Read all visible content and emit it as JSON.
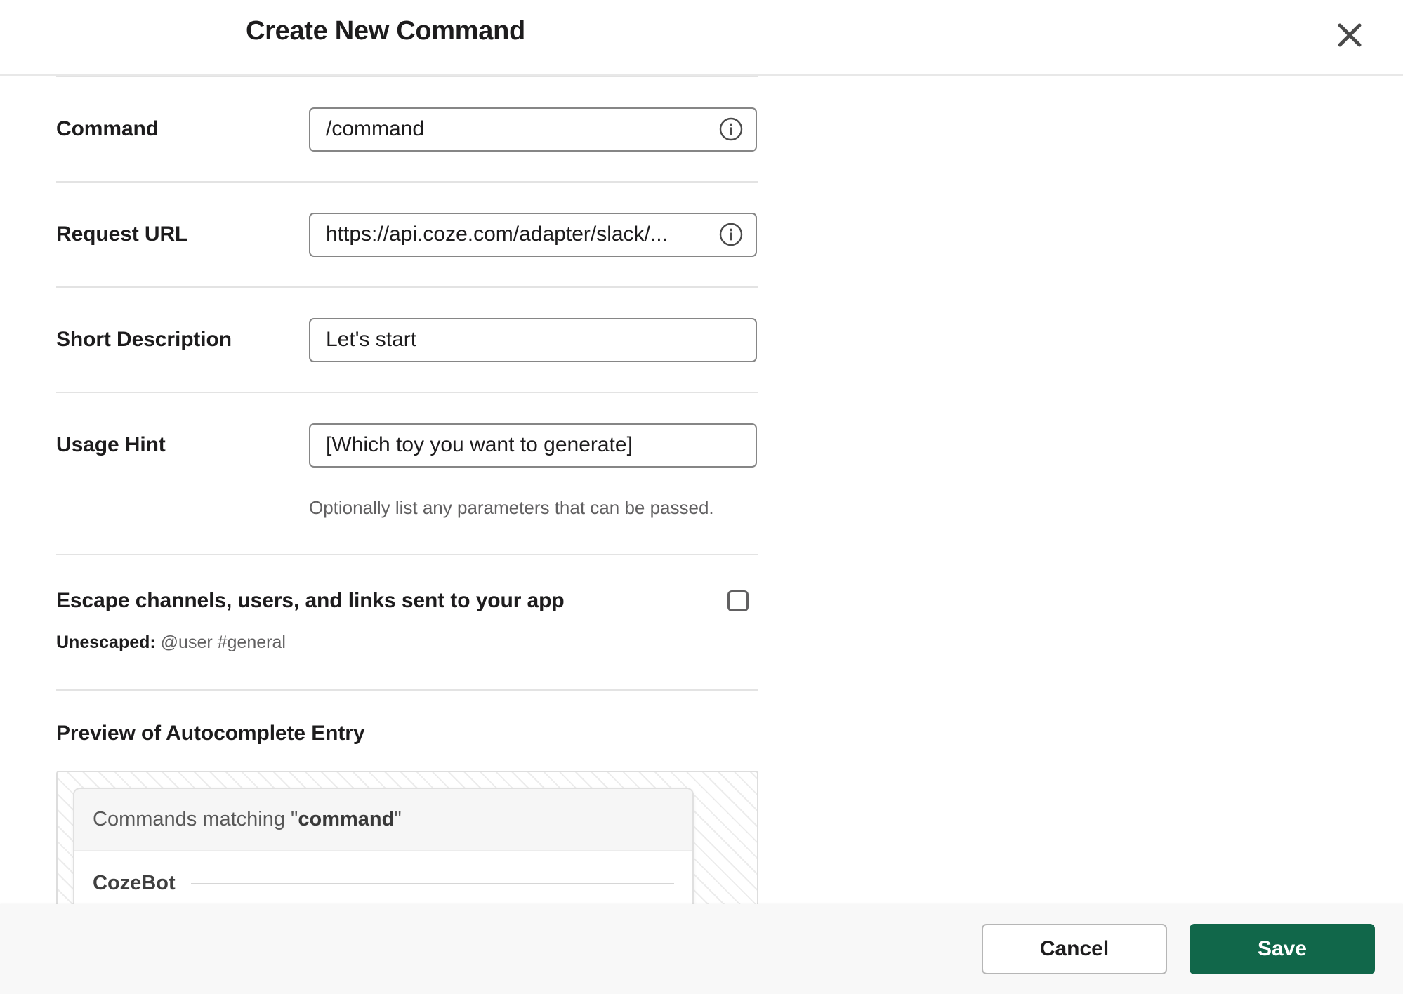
{
  "header": {
    "title": "Create New Command",
    "close_icon": "close-icon"
  },
  "form": {
    "fields": [
      {
        "label": "Command",
        "value": "/command",
        "has_info_icon": true,
        "info_icon": "info-circle-icon"
      },
      {
        "label": "Request URL",
        "value": "https://api.coze.com/adapter/slack/...",
        "has_info_icon": true,
        "info_icon": "info-circle-icon"
      },
      {
        "label": "Short Description",
        "value": "Let's start",
        "has_info_icon": false
      },
      {
        "label": "Usage Hint",
        "value": "[Which toy you want to generate]",
        "has_info_icon": false
      }
    ],
    "usage_hint_helper": "Optionally list any parameters that can be passed."
  },
  "escape": {
    "label": "Escape channels, users, and links sent to your app",
    "checked": false,
    "unescaped_label": "Unescaped:",
    "unescaped_value": "@user #general"
  },
  "preview": {
    "heading": "Preview of Autocomplete Entry",
    "matching_prefix": "Commands matching \"",
    "matching_term": "command",
    "matching_suffix": "\"",
    "group_name": "CozeBot"
  },
  "footer": {
    "cancel_label": "Cancel",
    "save_label": "Save"
  },
  "colors": {
    "save_green": "#11674a",
    "text_primary": "#1d1c1d",
    "text_secondary": "#616061",
    "border": "#868686",
    "footer_bg": "#f8f8f8"
  }
}
